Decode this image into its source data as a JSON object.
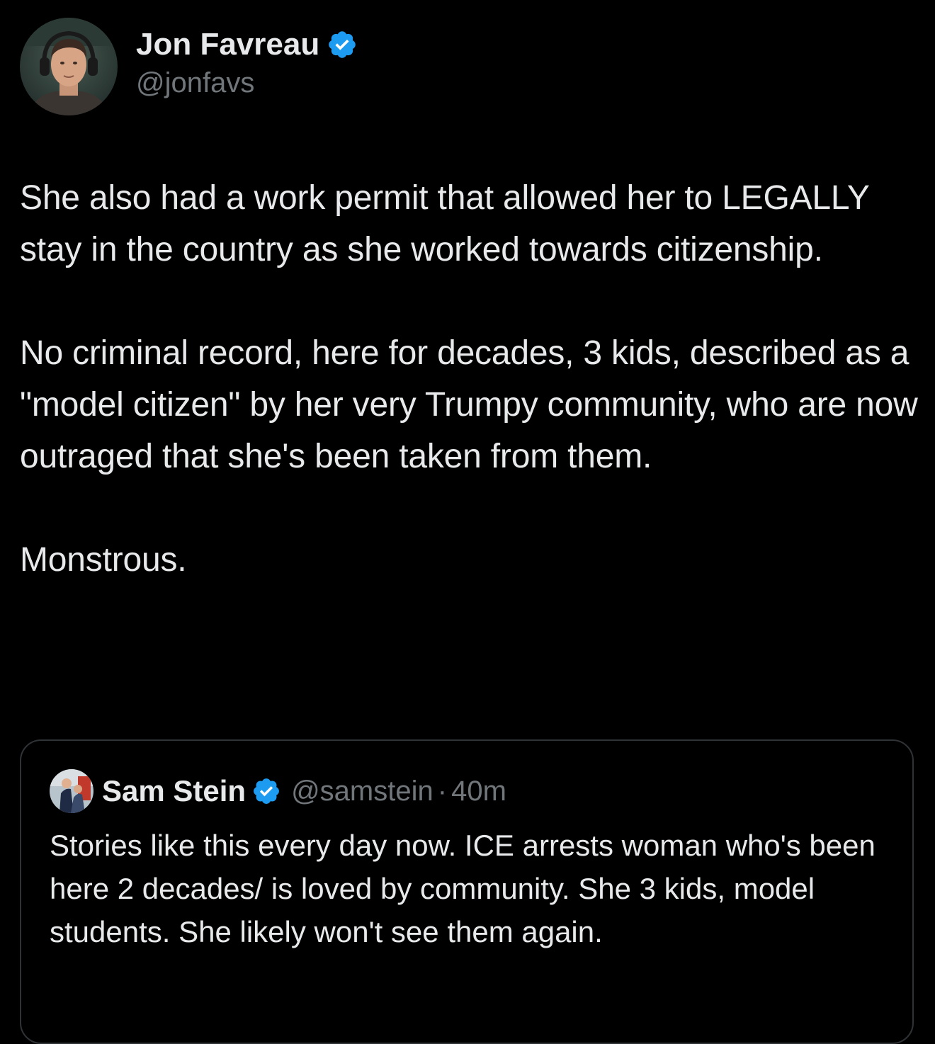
{
  "author": {
    "name": "Jon Favreau",
    "handle": "@jonfavs",
    "verified": true
  },
  "tweet": {
    "paragraphs": [
      "She also had a work permit that allowed her to LEGALLY stay in the country as she worked towards citizenship.",
      "No criminal record, here for decades, 3 kids, described as a \"model citizen\" by her very Trumpy community, who are now outraged that she's been taken from them.",
      "Monstrous."
    ]
  },
  "quote": {
    "name": "Sam Stein",
    "handle": "@samstein",
    "separator": "·",
    "time": "40m",
    "verified": true,
    "text": "Stories like this every day now. ICE arrests woman who's been here 2 decades/ is loved by community. She 3 kids, model students. She likely won't see them again."
  },
  "colors": {
    "background": "#000000",
    "text": "#e7e9ea",
    "secondary_text": "#71767b",
    "verified_badge": "#1d9bf0",
    "border": "#2f3336"
  },
  "icons": {
    "verified": "verified-badge-icon"
  }
}
